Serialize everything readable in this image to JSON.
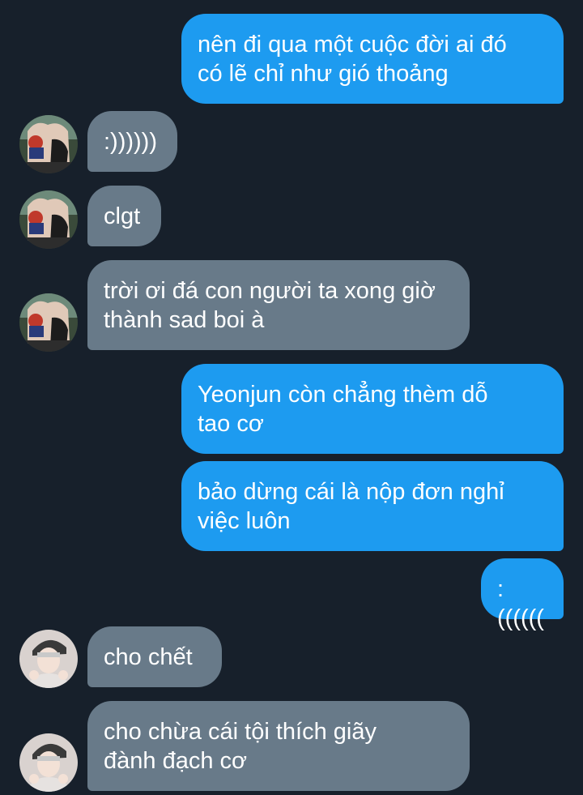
{
  "conversation": {
    "messages": [
      {
        "direction": "sent",
        "text": "nên đi qua một cuộc đời ai đó\ncó lẽ chỉ như gió thoảng"
      },
      {
        "direction": "received",
        "avatar": "anime-avatar",
        "text": ":))))))"
      },
      {
        "direction": "received",
        "avatar": "anime-avatar",
        "text": "clgt"
      },
      {
        "direction": "received",
        "avatar": "anime-avatar",
        "text": "trời ơi đá con người ta xong giờ\nthành sad boi à"
      },
      {
        "direction": "sent",
        "text": "Yeonjun còn chẳng thèm dỗ\ntao cơ"
      },
      {
        "direction": "sent",
        "text": "bảo dừng cái là nộp đơn nghỉ\nviệc luôn"
      },
      {
        "direction": "sent",
        "text": ":(((((("
      },
      {
        "direction": "received",
        "avatar": "person-avatar",
        "text": "cho chết"
      },
      {
        "direction": "received",
        "avatar": "person-avatar",
        "text": "cho chừa cái tội thích giãy\nđành đạch cơ"
      }
    ]
  },
  "colors": {
    "background": "#17202b",
    "sent_bubble": "#1d9bf0",
    "received_bubble": "#687a89",
    "text": "#ffffff"
  }
}
